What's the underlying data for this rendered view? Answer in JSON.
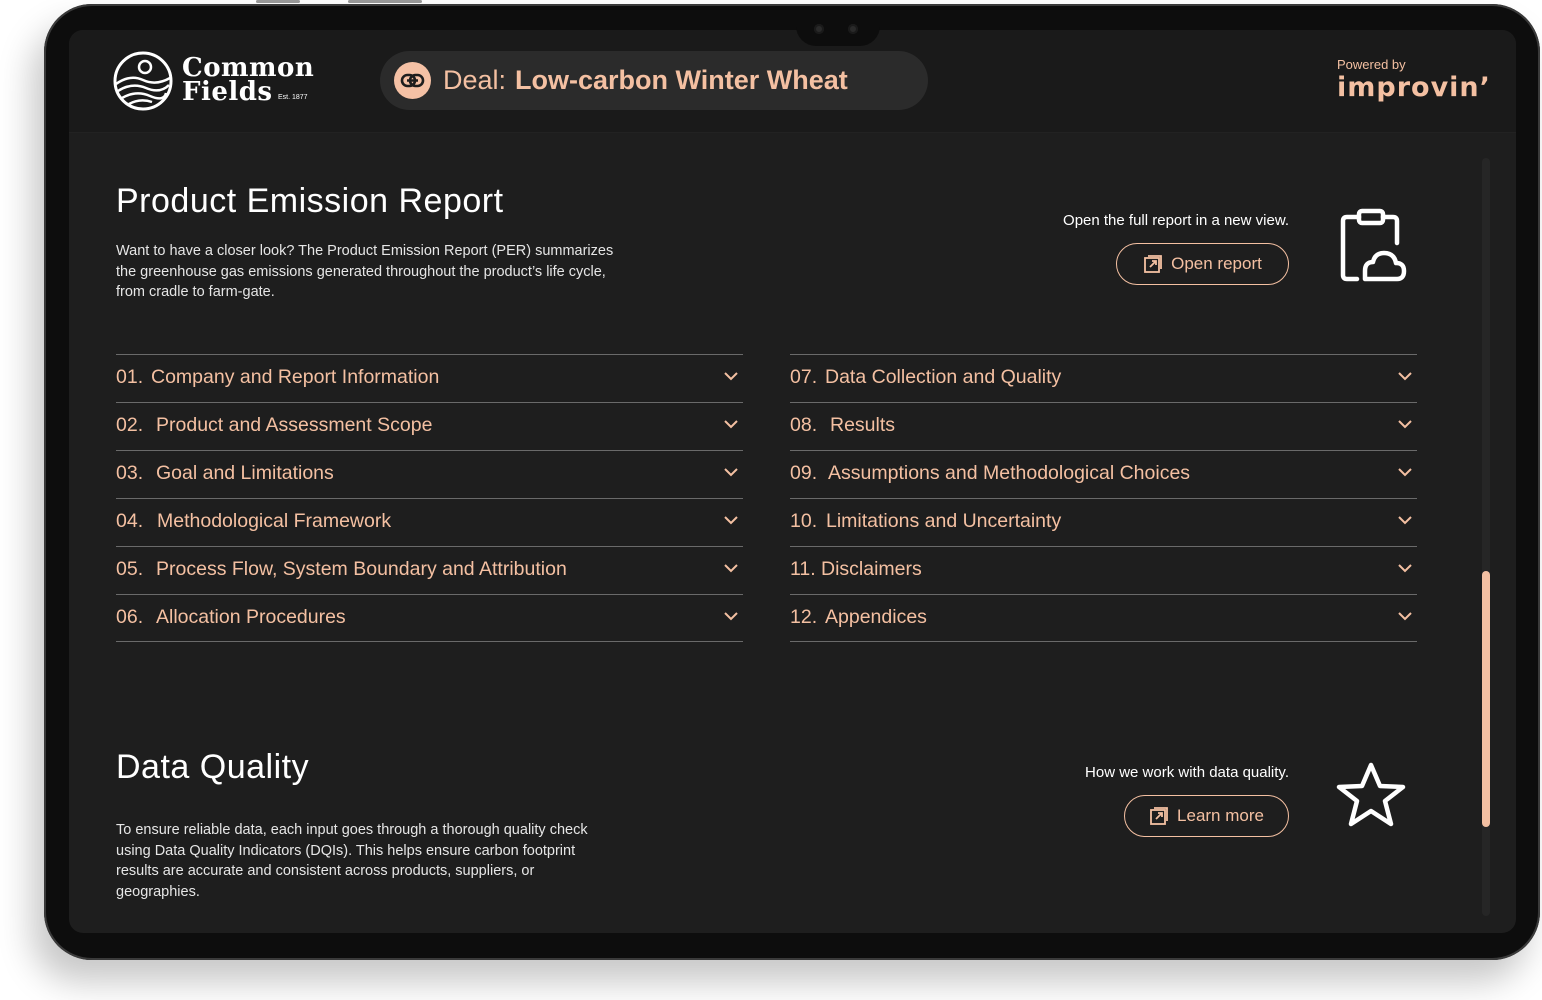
{
  "header": {
    "logo_line1": "Common",
    "logo_line2": "Fields",
    "logo_est": "Est. 1877",
    "deal_prefix": "Deal:",
    "deal_name": "Low-carbon Winter Wheat",
    "powered_by": "Powered by",
    "brand": "improvin’"
  },
  "per": {
    "title": "Product Emission Report",
    "description": "Want to have a closer look? The Product Emission Report (PER) summarizes the greenhouse gas emissions generated throughout the product’s life cycle, from cradle to farm-gate.",
    "cta_caption": "Open the full report in a new view.",
    "cta_label": "Open report",
    "sections_left": [
      {
        "num": "01.",
        "label": "Company and Report Information"
      },
      {
        "num": "02.",
        "label": "Product and Assessment Scope"
      },
      {
        "num": "03.",
        "label": "Goal and Limitations"
      },
      {
        "num": "04.",
        "label": "Methodological Framework"
      },
      {
        "num": "05.",
        "label": "Process Flow, System Boundary and Attribution"
      },
      {
        "num": "06.",
        "label": "Allocation Procedures"
      }
    ],
    "sections_right": [
      {
        "num": "07.",
        "label": "Data Collection and Quality"
      },
      {
        "num": "08.",
        "label": "Results"
      },
      {
        "num": "09.",
        "label": "Assumptions and Methodological Choices"
      },
      {
        "num": "10.",
        "label": "Limitations and Uncertainty"
      },
      {
        "num": "11.",
        "label": "Disclaimers"
      },
      {
        "num": "12.",
        "label": "Appendices"
      }
    ]
  },
  "dq": {
    "title": "Data Quality",
    "description": "To ensure reliable data, each input goes through a thorough quality check using Data Quality Indicators (DQIs). This helps ensure carbon footprint results are accurate and consistent across products, suppliers, or geographies.",
    "cta_caption": "How we work with data quality.",
    "cta_label": "Learn more"
  },
  "colors": {
    "accent": "#f4c0a2",
    "background": "#1e1e1e",
    "header": "#1a1a1a"
  },
  "icons": {
    "deal": "link-icon",
    "open_report": "external-link-icon",
    "per_feature": "clipboard-cloud-icon",
    "dq_feature": "star-icon",
    "accordion": "chevron-down-icon"
  }
}
